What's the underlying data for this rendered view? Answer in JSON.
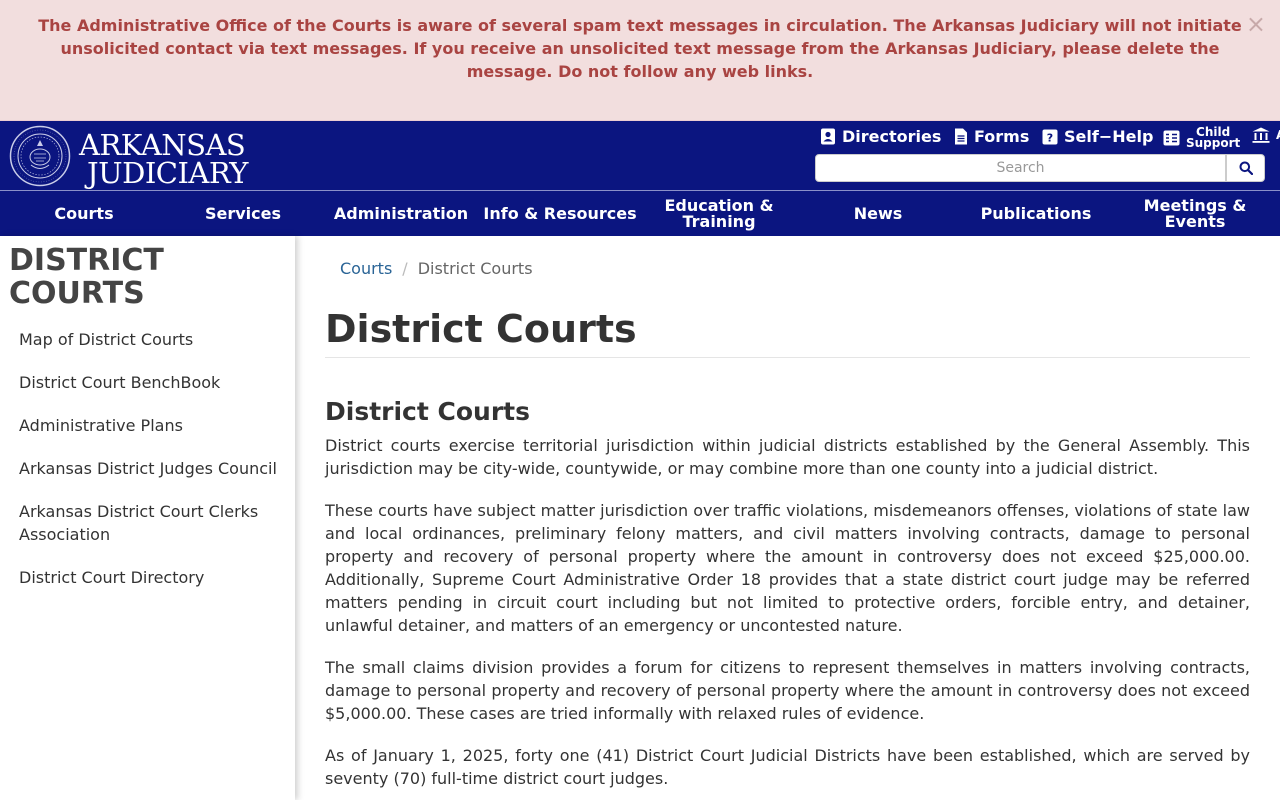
{
  "alert": {
    "message": "The Administrative Office of the Courts is aware of several spam text messages in circulation.  The Arkansas Judiciary will not initiate unsolicited contact via text messages. If you receive an unsolicited text message from the Arkansas Judiciary, please delete the message. Do not follow any web links.",
    "close_label": "×"
  },
  "header": {
    "logo_line1": "ARKANSAS",
    "logo_line2": "JUDICIARY",
    "utility_links": {
      "directories": "Directories",
      "forms": "Forms",
      "self_help": "Self−Help",
      "child_support_line1": "Child",
      "child_support_line2": "Support",
      "cut_off": "A"
    },
    "search_placeholder": "Search"
  },
  "nav": {
    "items": [
      {
        "label": "Courts"
      },
      {
        "label": "Services"
      },
      {
        "label": "Administration"
      },
      {
        "label": "Info & Resources"
      },
      {
        "label": "Education & Training"
      },
      {
        "label": "News"
      },
      {
        "label": "Publications"
      },
      {
        "label": "Meetings & Events"
      }
    ]
  },
  "sidebar": {
    "title": "DISTRICT COURTS",
    "links": [
      {
        "label": "Map of District Courts"
      },
      {
        "label": "District Court BenchBook"
      },
      {
        "label": "Administrative Plans"
      },
      {
        "label": "Arkansas District Judges Council"
      },
      {
        "label": "Arkansas District Court Clerks Association"
      },
      {
        "label": "District Court Directory"
      }
    ]
  },
  "main": {
    "breadcrumb": {
      "parent": "Courts",
      "separator": "/",
      "current": "District Courts"
    },
    "page_title": "District Courts",
    "section_title": "District Courts",
    "paragraphs": [
      "District courts exercise territorial jurisdiction within judicial districts established by the General Assembly. This jurisdiction may be city-wide, countywide, or may combine more than one county into a judicial district.",
      "These courts have subject matter jurisdiction over traffic violations, misdemeanors offenses, violations of state law and local ordinances, preliminary felony matters, and civil matters involving contracts, damage to personal property and recovery of personal property where the amount in controversy does not exceed $25,000.00. Additionally, Supreme Court Administrative Order 18 provides that a state district court judge may be referred matters pending in circuit court including but not limited to protective orders, forcible entry, and detainer, unlawful detainer, and matters of an emergency or uncontested nature.",
      "The small claims division provides a forum for citizens to represent themselves in matters involving contracts, damage to personal property and recovery of personal property where the amount in controversy does not exceed $5,000.00. These cases are tried informally with relaxed rules of evidence.",
      "As of January 1, 2025, forty one (41) District Court Judicial Districts have been established, which are served by seventy (70) full-time district court judges."
    ]
  },
  "colors": {
    "header_bg": "#0b1580",
    "alert_bg": "#f2dede",
    "alert_text": "#a94442",
    "link": "#2a6496"
  }
}
